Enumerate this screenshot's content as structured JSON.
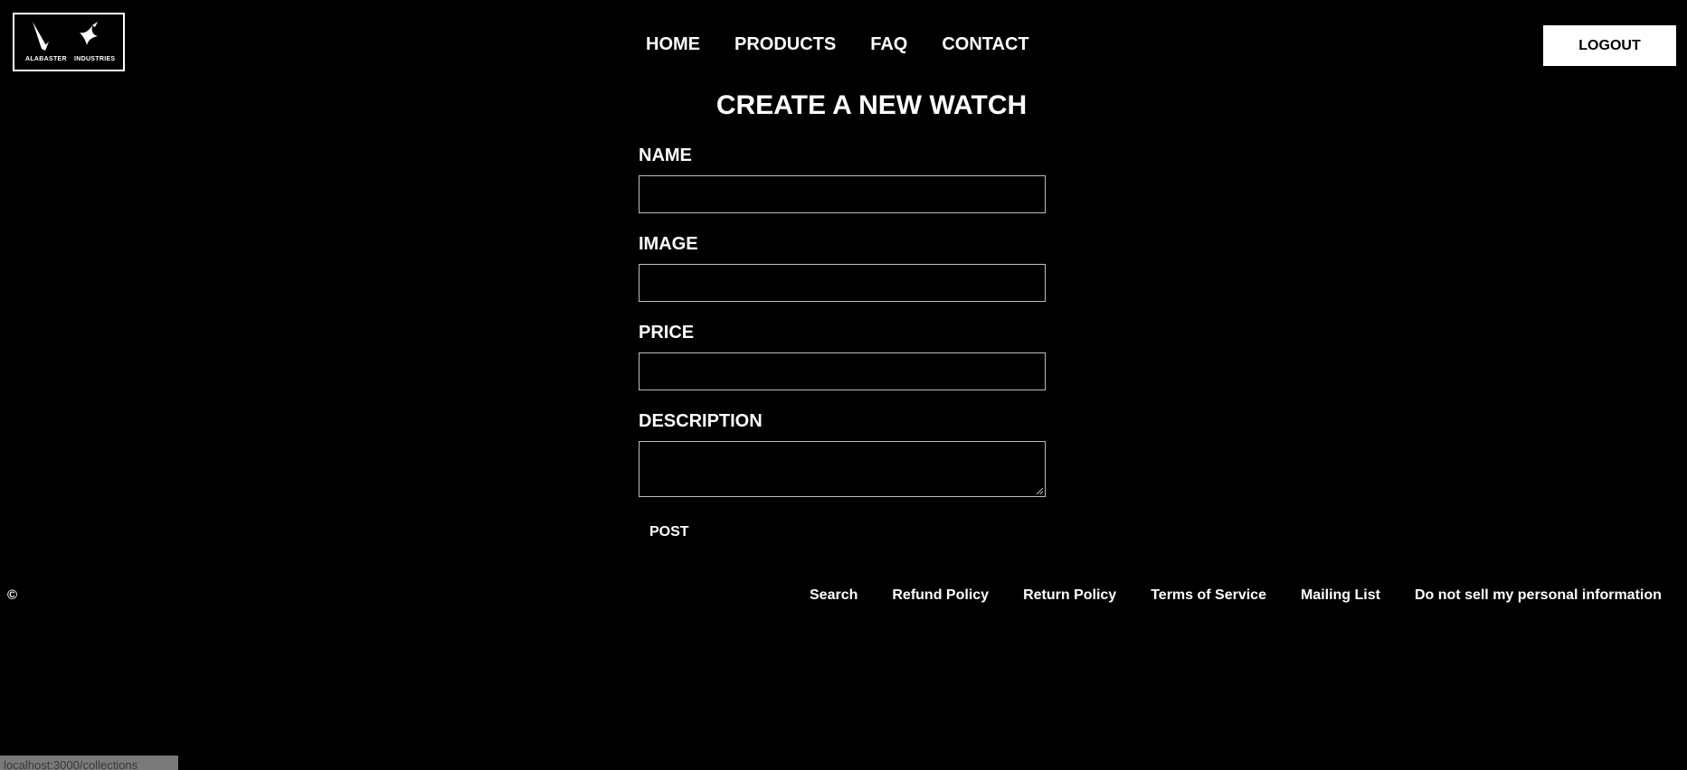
{
  "header": {
    "logo": {
      "left_text": "ALABASTER",
      "right_text": "INDUSTRIES"
    },
    "nav": [
      {
        "label": "HOME"
      },
      {
        "label": "PRODUCTS"
      },
      {
        "label": "FAQ"
      },
      {
        "label": "CONTACT"
      }
    ],
    "logout_label": "LOGOUT"
  },
  "form": {
    "title": "CREATE A NEW WATCH",
    "fields": {
      "name": {
        "label": "NAME",
        "value": ""
      },
      "image": {
        "label": "IMAGE",
        "value": ""
      },
      "price": {
        "label": "PRICE",
        "value": ""
      },
      "description": {
        "label": "DESCRIPTION",
        "value": ""
      }
    },
    "submit_label": "POST"
  },
  "footer": {
    "copyright": "©",
    "links": [
      {
        "label": "Search"
      },
      {
        "label": "Refund Policy"
      },
      {
        "label": "Return Policy"
      },
      {
        "label": "Terms of Service"
      },
      {
        "label": "Mailing List"
      },
      {
        "label": "Do not sell my personal information"
      }
    ]
  },
  "status_bar": {
    "url": "localhost:3000/collections"
  },
  "colors": {
    "background": "#000000",
    "text": "#ffffff",
    "input_border": "#bdbdbd",
    "button_bg": "#ffffff"
  }
}
